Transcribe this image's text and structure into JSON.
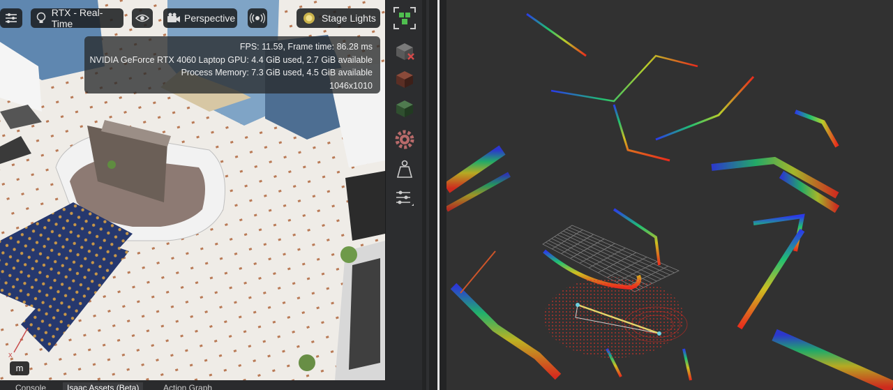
{
  "viewport_toolbar": {
    "settings_icon": "sliders-icon",
    "render_mode": {
      "icon": "lightbulb-icon",
      "label": "RTX - Real-Time"
    },
    "visibility_icon": "eye-icon",
    "camera": {
      "icon": "camera-icon",
      "label": "Perspective"
    },
    "broadcast_icon": "broadcast-icon",
    "lighting": {
      "icon": "sun-icon",
      "label": "Stage Lights"
    }
  },
  "stats": {
    "fps_line": "FPS: 11.59, Frame time: 86.28 ms",
    "gpu_line": "NVIDIA GeForce RTX 4060 Laptop GPU: 4.4 GiB used, 2.7 GiB available",
    "memory_line": "Process Memory: 7.3 GiB used, 4.5 GiB available",
    "resolution_line": "1046x1010"
  },
  "unit_badge": "m",
  "bottom_tabs": [
    {
      "label": "Console",
      "active": false
    },
    {
      "label": "Isaac Assets (Beta)",
      "active": true
    },
    {
      "label": "Action Graph",
      "active": false
    }
  ],
  "side_toolbar": {
    "icons": [
      "frame-selection-icon",
      "delete-cube-icon",
      "dark-cube-icon",
      "green-cube-icon",
      "gear-icon",
      "mass-weight-icon",
      "sliders-menu-icon"
    ]
  },
  "colors": {
    "panel_bg": "#2c2d2f",
    "rviz_bg": "#313131",
    "accent_green": "#4fbf4f",
    "stats_text": "#f0f0f0"
  }
}
